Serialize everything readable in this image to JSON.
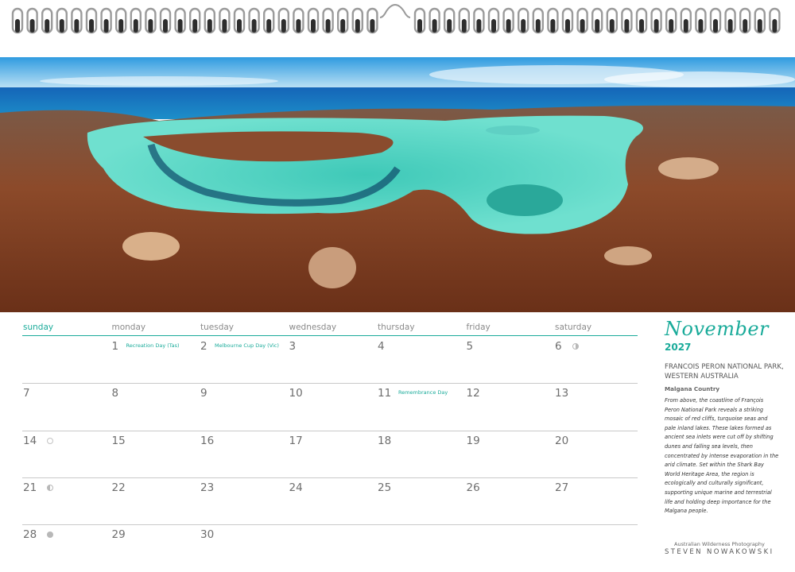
{
  "calendar": {
    "month": "November",
    "year": "2027",
    "weekdays": [
      "sunday",
      "monday",
      "tuesday",
      "wednesday",
      "thursday",
      "friday",
      "saturday"
    ],
    "weeks": [
      [
        {
          "day": ""
        },
        {
          "day": "1",
          "holiday": "Recreation Day (Tas)"
        },
        {
          "day": "2",
          "holiday": "Melbourne Cup Day (Vic)"
        },
        {
          "day": "3"
        },
        {
          "day": "4"
        },
        {
          "day": "5"
        },
        {
          "day": "6",
          "moon": "first-quarter"
        }
      ],
      [
        {
          "day": "7"
        },
        {
          "day": "8"
        },
        {
          "day": "9"
        },
        {
          "day": "10"
        },
        {
          "day": "11",
          "holiday": "Remembrance Day"
        },
        {
          "day": "12"
        },
        {
          "day": "13"
        }
      ],
      [
        {
          "day": "14",
          "moon": "full"
        },
        {
          "day": "15"
        },
        {
          "day": "16"
        },
        {
          "day": "17"
        },
        {
          "day": "18"
        },
        {
          "day": "19"
        },
        {
          "day": "20"
        }
      ],
      [
        {
          "day": "21",
          "moon": "last-quarter"
        },
        {
          "day": "22"
        },
        {
          "day": "23"
        },
        {
          "day": "24"
        },
        {
          "day": "25"
        },
        {
          "day": "26"
        },
        {
          "day": "27"
        }
      ],
      [
        {
          "day": "28",
          "moon": "new"
        },
        {
          "day": "29"
        },
        {
          "day": "30"
        },
        {
          "day": ""
        },
        {
          "day": ""
        },
        {
          "day": ""
        },
        {
          "day": ""
        }
      ]
    ]
  },
  "photo_info": {
    "location": "FRANCOIS PERON NATIONAL PARK, WESTERN AUSTRALIA",
    "country": "Malgana Country",
    "description": "From above, the coastline of François Peron National Park reveals a striking mosaic of red cliffs, turquoise seas and pale inland lakes. These lakes formed as ancient sea inlets were cut off by shifting dunes and falling sea levels, then concentrated by intense evaporation in the arid climate. Set within the Shark Bay World Heritage Area, the region is ecologically and culturally significant, supporting unique marine and terrestrial life and holding deep importance for the Malgana people."
  },
  "credit": {
    "line1": "Australian Wilderness Photography",
    "line2": "STEVEN NOWAKOWSKI"
  },
  "colors": {
    "accent": "#1aab9a",
    "day_number": "#6e6e6e",
    "grid_line": "#c9c9c9"
  }
}
